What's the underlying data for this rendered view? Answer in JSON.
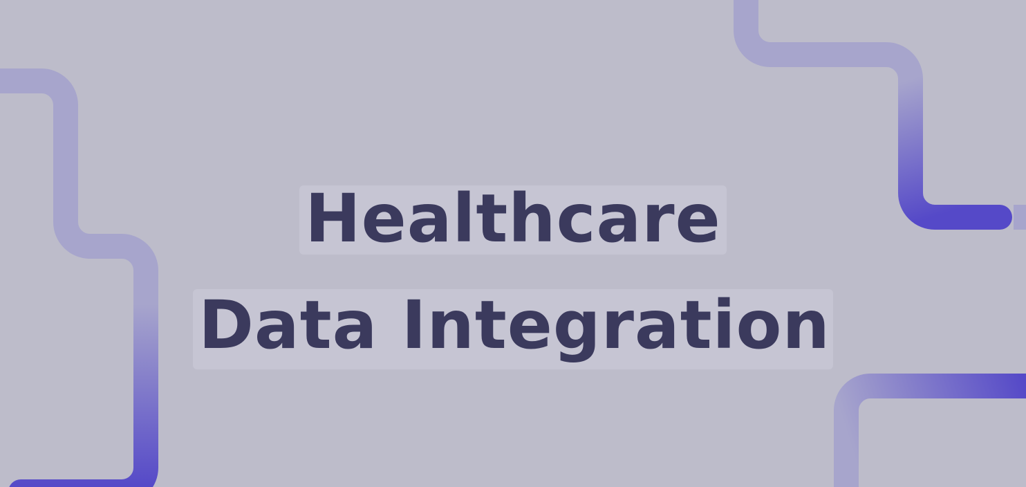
{
  "title": {
    "line1": "Healthcare",
    "line2": "Data Integration"
  },
  "colors": {
    "background": "#bdbcca",
    "text": "#3b3a5d",
    "text_highlight": "#c6c5d3",
    "line_light": "#a7a5cc",
    "line_accent": "#5549c8"
  }
}
